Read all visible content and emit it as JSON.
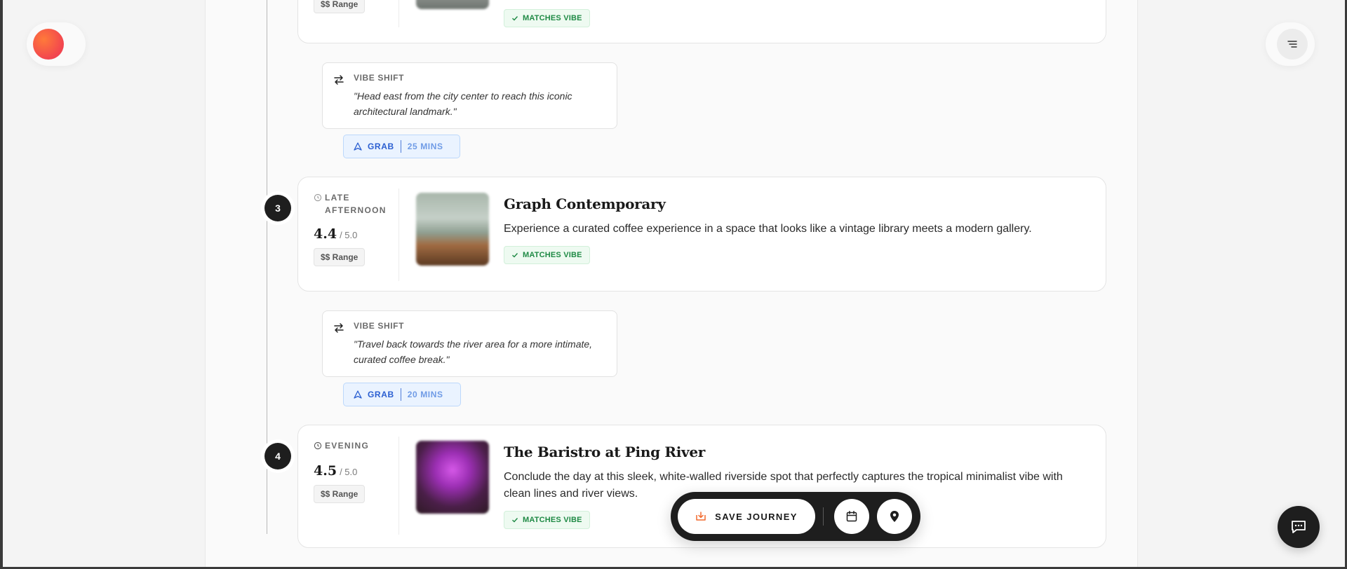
{
  "itinerary": {
    "top_card": {
      "price": "$$ Range",
      "vibe_label": "MATCHES VIBE"
    },
    "shift_1": {
      "title": "VIBE SHIFT",
      "text": "\"Head east from the city center to reach this iconic architectural landmark.\"",
      "mode": "GRAB",
      "duration": "25 MINS"
    },
    "stop_3": {
      "number": "3",
      "time_of_day": "LATE AFTERNOON",
      "rating": "4.4",
      "rating_max": "/ 5.0",
      "price": "$$ Range",
      "name": "Graph Contemporary",
      "description": "Experience a curated coffee experience in a space that looks like a vintage library meets a modern gallery.",
      "vibe_label": "MATCHES VIBE"
    },
    "shift_2": {
      "title": "VIBE SHIFT",
      "text": "\"Travel back towards the river area for a more intimate, curated coffee break.\"",
      "mode": "GRAB",
      "duration": "20 MINS"
    },
    "stop_4": {
      "number": "4",
      "time_of_day": "EVENING",
      "rating": "4.5",
      "rating_max": "/ 5.0",
      "price": "$$ Range",
      "name": "The Baristro at Ping River",
      "description": "Conclude the day at this sleek, white-walled riverside spot that perfectly captures the tropical minimalist vibe with clean lines and river views.",
      "vibe_label": "MATCHES VIBE"
    }
  },
  "action_bar": {
    "save_label": "SAVE JOURNEY"
  },
  "icons": {
    "logo": "brand-logo",
    "menu": "menu-icon",
    "clock": "clock-icon",
    "swap": "swap-icon",
    "navigation": "navigation-icon",
    "check": "check-icon",
    "download": "download-icon",
    "calendar": "calendar-icon",
    "map_pin": "map-pin-icon",
    "chat": "chat-icon"
  },
  "colors": {
    "brand_gradient_start": "#ff7a3a",
    "brand_gradient_end": "#f2454f",
    "vibe_green": "#1f8a45",
    "transport_blue": "#2b5fd1",
    "save_icon_orange": "#f26a2e",
    "dark": "#1e1e1e"
  }
}
